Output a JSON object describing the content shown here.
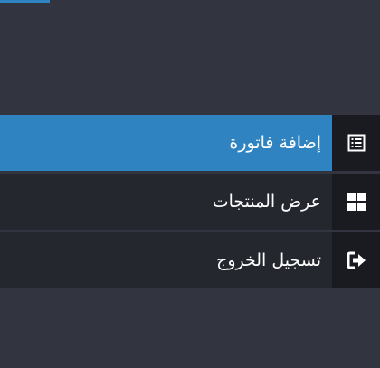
{
  "menu": {
    "items": [
      {
        "label": "إضافة فاتورة",
        "icon": "invoice-list-icon",
        "active": true
      },
      {
        "label": "عرض المنتجات",
        "icon": "grid-icon",
        "active": false
      },
      {
        "label": "تسجيل الخروج",
        "icon": "sign-out-icon",
        "active": false
      }
    ]
  },
  "colors": {
    "background": "#32353f",
    "item_background": "#25272f",
    "active_background": "#2e83c0",
    "icon_box_background": "#1a1b21",
    "text": "#ffffff"
  }
}
